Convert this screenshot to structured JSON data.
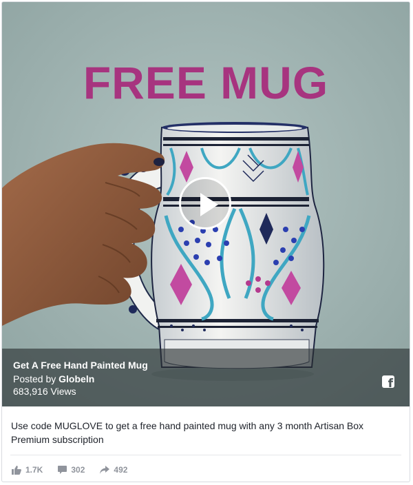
{
  "video": {
    "headline": "FREE MUG",
    "title": "Get A Free Hand Painted Mug",
    "posted_by_prefix": "Posted by ",
    "posted_by_name": "Globeln",
    "views": "683,916 Views",
    "play_icon": "play-icon",
    "brand_icon": "facebook-icon",
    "brand_letter": "f"
  },
  "post": {
    "caption": "Use code MUGLOVE to get a free hand painted mug with any 3 month Artisan Box Premium subscription"
  },
  "engagement": {
    "likes": "1.7K",
    "comments": "302",
    "shares": "492"
  },
  "colors": {
    "headline": "#a7347f",
    "background": "#9fb3b1",
    "overlay": "#282e30"
  }
}
